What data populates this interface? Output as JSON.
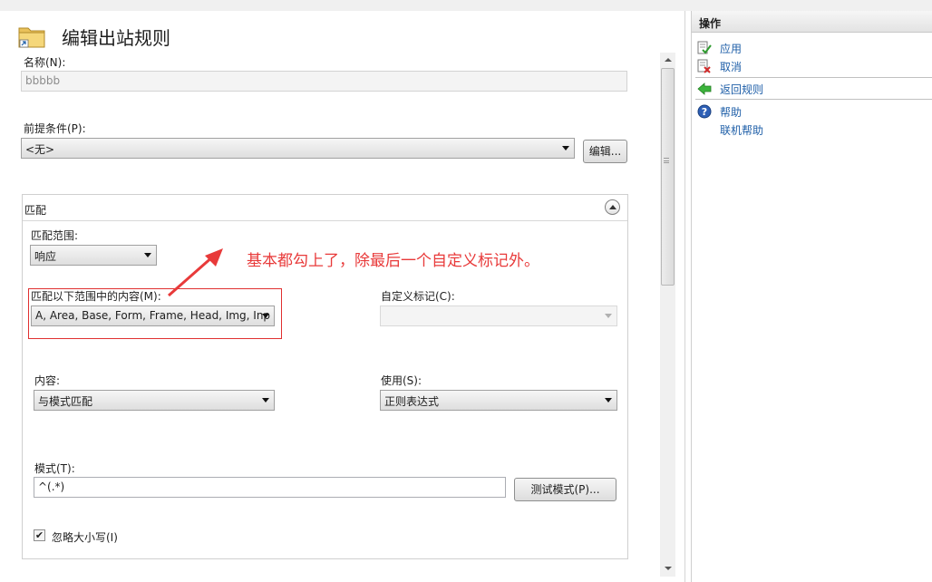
{
  "page": {
    "title": "编辑出站规则"
  },
  "form": {
    "name_label": "名称(N):",
    "name_value": "bbbbb",
    "precondition_label": "前提条件(P):",
    "precondition_value": "<无>",
    "edit_button": "编辑...",
    "match_section_title": "匹配",
    "match_scope_label": "匹配范围:",
    "match_scope_value": "响应",
    "match_content_label": "匹配以下范围中的内容(M):",
    "match_content_value": "A, Area, Base, Form, Frame, Head, Img, Inp",
    "custom_tag_label": "自定义标记(C):",
    "custom_tag_value": "",
    "content_label": "内容:",
    "content_value": "与模式匹配",
    "using_label": "使用(S):",
    "using_value": "正则表达式",
    "pattern_label": "模式(T):",
    "pattern_value": "^(.*)",
    "test_pattern_button": "测试模式(P)...",
    "ignore_case_label": "忽略大小写(I)",
    "ignore_case_checked": true
  },
  "annotation": {
    "text": "基本都勾上了，除最后一个自定义标记外。",
    "color": "#e83a3a"
  },
  "actions_panel": {
    "title": "操作",
    "items": [
      {
        "label": "应用",
        "icon": "apply-check-icon"
      },
      {
        "label": "取消",
        "icon": "cancel-x-icon"
      },
      {
        "label": "返回规则",
        "icon": "back-arrow-icon"
      },
      {
        "label": "帮助",
        "icon": "help-icon"
      },
      {
        "label": "联机帮助",
        "icon": ""
      }
    ],
    "link_color": "#1f5fa8"
  }
}
